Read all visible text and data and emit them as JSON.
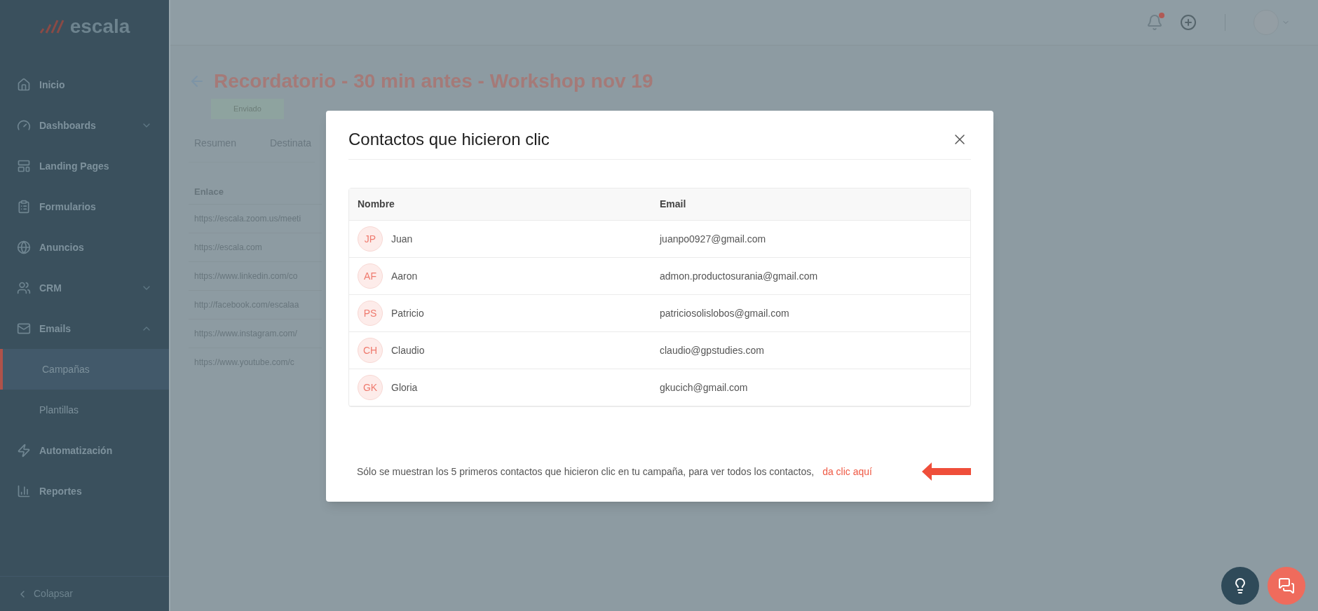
{
  "sidebar": {
    "logo": "escala",
    "items": [
      {
        "label": "Inicio",
        "selected": false
      },
      {
        "label": "Dashboards",
        "selected": false,
        "expanded": false
      },
      {
        "label": "Landing Pages",
        "selected": false
      },
      {
        "label": "Formularios",
        "selected": false
      },
      {
        "label": "Anuncios",
        "selected": false
      },
      {
        "label": "CRM",
        "selected": false,
        "expanded": false
      },
      {
        "label": "Emails",
        "selected": false,
        "expanded": true,
        "children": [
          {
            "label": "Campañas",
            "selected": true
          },
          {
            "label": "Plantillas",
            "selected": false
          }
        ]
      },
      {
        "label": "Automatización",
        "selected": false
      },
      {
        "label": "Reportes",
        "selected": false
      }
    ],
    "collapse": "Colapsar"
  },
  "topbar": {
    "notifications_unread": true
  },
  "page": {
    "title": "Recordatorio - 30 min antes - Workshop nov 19",
    "status": "Enviado",
    "tabs": [
      "Resumen",
      "Destinata"
    ],
    "links_table": {
      "column": "Enlace",
      "rows": [
        "https://escala.zoom.us/meeti",
        "https://escala.com",
        "https://www.linkedin.com/co",
        "http://facebook.com/escalaa",
        "https://www.instagram.com/",
        "https://www.youtube.com/c"
      ]
    }
  },
  "modal": {
    "title": "Contactos que hicieron clic",
    "columns": [
      "Nombre",
      "Email"
    ],
    "rows": [
      {
        "initials": "JP",
        "name": "Juan",
        "email": "juanpo0927@gmail.com"
      },
      {
        "initials": "AF",
        "name": "Aaron",
        "email": "admon.productosurania@gmail.com"
      },
      {
        "initials": "PS",
        "name": "Patricio",
        "email": "patriciosolislobos@gmail.com"
      },
      {
        "initials": "CH",
        "name": "Claudio",
        "email": "claudio@gpstudies.com"
      },
      {
        "initials": "GK",
        "name": "Gloria",
        "email": "gkucich@gmail.com"
      }
    ],
    "footer_text": "Sólo se muestran los 5 primeros contactos que hicieron clic en tu campaña, para ver todos los contactos,",
    "footer_link": "da clic aquí"
  }
}
